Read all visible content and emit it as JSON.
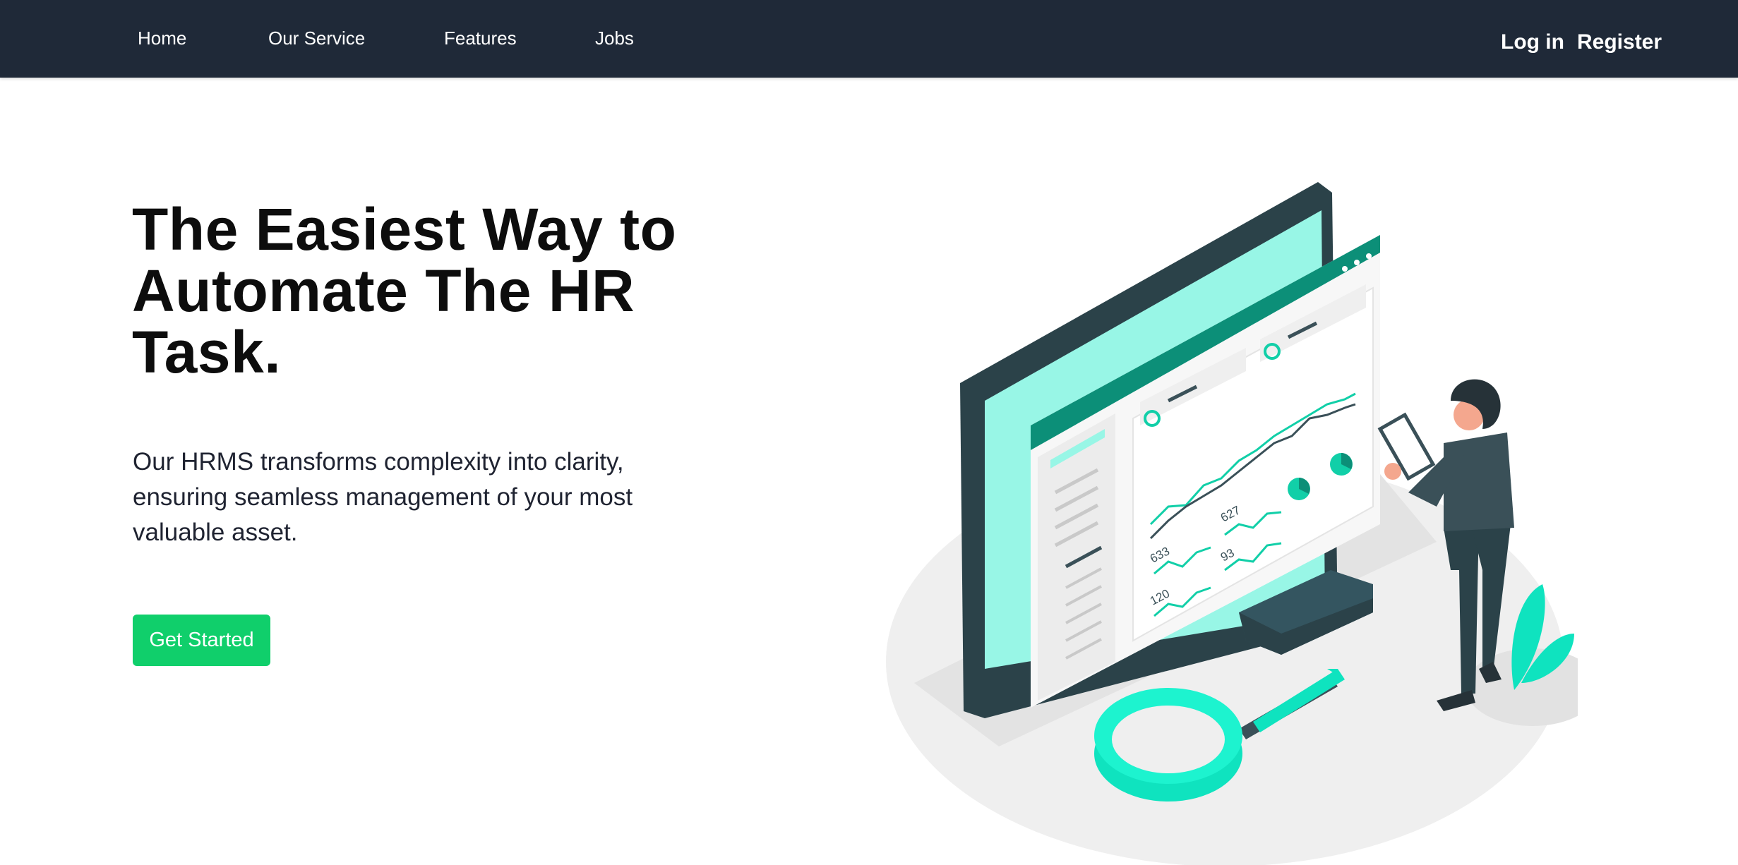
{
  "nav": {
    "links": [
      "Home",
      "Our Service",
      "Features",
      "Jobs"
    ],
    "login": "Log in",
    "register": "Register"
  },
  "hero": {
    "title": "The Easiest Way to Automate The HR Task.",
    "description": "Our HRMS transforms complexity into clarity, ensuring seamless management of your most valuable asset.",
    "cta": "Get Started"
  },
  "illustration": {
    "stats": [
      "627",
      "633",
      "93",
      "120"
    ]
  },
  "colors": {
    "navbar": "#1f2938",
    "accent": "#10cf6b",
    "teal": "#0fe3bf",
    "monitor": "#2b4249"
  }
}
